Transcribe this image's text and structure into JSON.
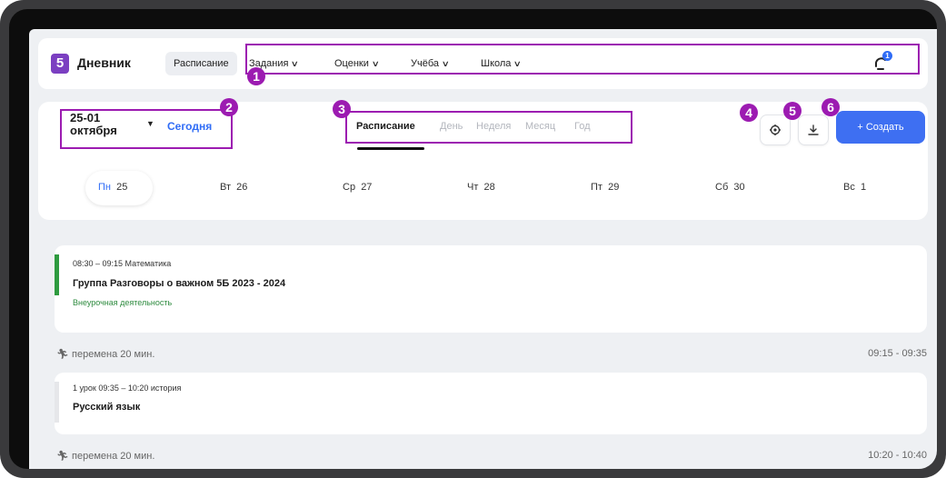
{
  "app": {
    "logo": "5",
    "name": "Дневник"
  },
  "nav": {
    "active": "Расписание",
    "items": [
      "Задания",
      "Оценки",
      "Учёба",
      "Школа"
    ],
    "notifications_count": "1"
  },
  "calendar": {
    "date_range_line1": "25-01",
    "date_range_line2": "октября",
    "today": "Сегодня",
    "view_tabs": [
      "Расписание",
      "День",
      "Неделя",
      "Месяц",
      "Год"
    ],
    "create_label": "+ Создать",
    "days": [
      {
        "name": "Пн",
        "num": "25"
      },
      {
        "name": "Вт",
        "num": "26"
      },
      {
        "name": "Ср",
        "num": "27"
      },
      {
        "name": "Чт",
        "num": "28"
      },
      {
        "name": "Пт",
        "num": "29"
      },
      {
        "name": "Сб",
        "num": "30"
      },
      {
        "name": "Вс",
        "num": "1"
      }
    ]
  },
  "schedule": {
    "lesson1": {
      "time": "08:30 – 09:15 Математика",
      "title": "Группа Разговоры о важном 5Б 2023 - 2024",
      "type": "Внеурочная деятельность",
      "color": "#2e9b3f"
    },
    "break1": {
      "label": "перемена 20 мин.",
      "time": "09:15 - 09:35"
    },
    "lesson2": {
      "time": "1 урок 09:35 – 10:20 история",
      "title": "Русский язык",
      "color": "#e6e7ea"
    },
    "break2": {
      "label": "перемена 20 мин.",
      "time": "10:20 - 10:40"
    }
  },
  "annotations": [
    "1",
    "2",
    "3",
    "4",
    "5",
    "6"
  ],
  "colors": {
    "accent": "#3e6ff2",
    "annotation": "#9c1bb1"
  }
}
